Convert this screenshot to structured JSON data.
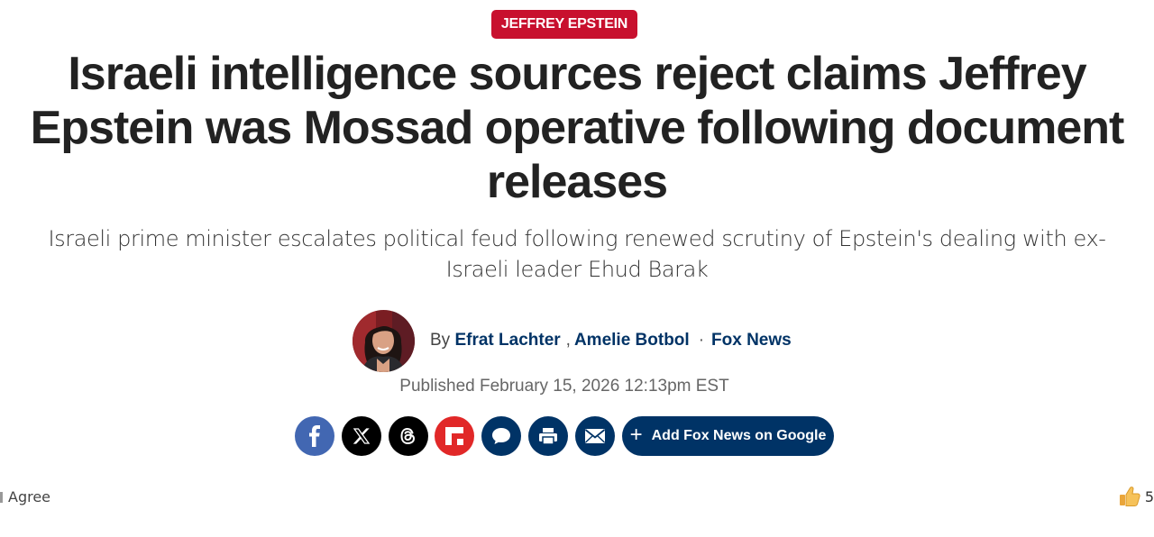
{
  "article": {
    "category": "JEFFREY EPSTEIN",
    "headline": "Israeli intelligence sources reject claims Jeffrey Epstein was Mossad operative following document releases",
    "subheadline": "Israeli prime minister escalates political feud following renewed scrutiny of Epstein's dealing with ex-Israeli leader Ehud Barak",
    "byline": {
      "prefix": "By",
      "authors": [
        "Efrat Lachter",
        "Amelie Botbol"
      ],
      "author_separator": ",",
      "dot": "·",
      "outlet": "Fox News"
    },
    "published": "Published February 15, 2026 12:13pm EST"
  },
  "share": {
    "buttons": [
      {
        "icon": "facebook-icon",
        "color": "#4267b2"
      },
      {
        "icon": "x-icon",
        "color": "#000000"
      },
      {
        "icon": "threads-icon",
        "color": "#000000"
      },
      {
        "icon": "flipboard-icon",
        "color": "#e12828"
      },
      {
        "icon": "comments-icon",
        "color": "#003366"
      },
      {
        "icon": "print-icon",
        "color": "#003366"
      },
      {
        "icon": "email-icon",
        "color": "#003366"
      }
    ],
    "google_button_label": "Add Fox News on Google"
  },
  "reactions": {
    "agree_label": "Agree",
    "like_count": "5"
  },
  "colors": {
    "brand_red": "#c8102e",
    "brand_navy": "#003366"
  }
}
